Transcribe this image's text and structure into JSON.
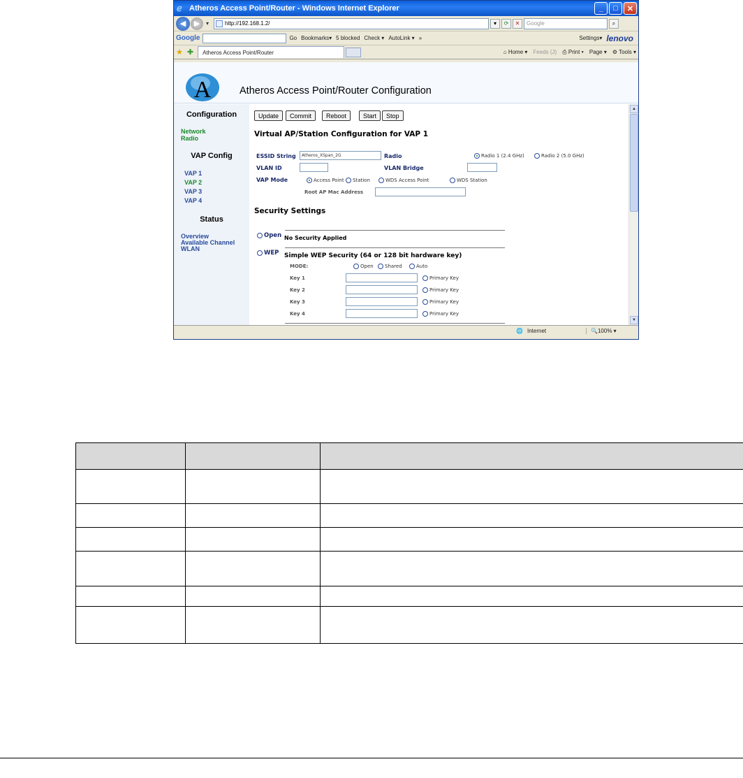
{
  "window": {
    "title": "Atheros Access Point/Router - Windows Internet Explorer"
  },
  "address_bar": {
    "url": "http://192.168.1.2/",
    "search_placeholder": "Google"
  },
  "google_toolbar": {
    "logo": "Google",
    "go": "Go",
    "bookmarks": "Bookmarks▾",
    "blocked": "5 blocked",
    "check": "Check ▾",
    "autolink": "AutoLink ▾",
    "more": "»",
    "settings": "Settings▾",
    "brand": "lenovo"
  },
  "tab_bar": {
    "tab_title": "Atheros Access Point/Router",
    "home": "Home",
    "feeds": "Feeds (J)",
    "print": "Print",
    "page": "Page ▾",
    "tools": "Tools ▾"
  },
  "page": {
    "title": "Atheros Access Point/Router Configuration",
    "logo_letter": "A"
  },
  "sidebar": {
    "config_heading": "Configuration",
    "network": "Network",
    "radio": "Radio",
    "vap_heading": "VAP Config",
    "vaps": [
      "VAP 1",
      "VAP 2",
      "VAP 3",
      "VAP 4"
    ],
    "status_heading": "Status",
    "overview": "Overview",
    "available_channel": "Available Channel",
    "wlan": "WLAN"
  },
  "buttons": {
    "update": "Update",
    "commit": "Commit",
    "reboot": "Reboot",
    "start": "Start",
    "stop": "Stop"
  },
  "vap_form": {
    "heading": "Virtual AP/Station Configuration for VAP 1",
    "essid_label": "ESSID String",
    "essid_value": "Atheros_XSpan_2G",
    "radio_label": "Radio",
    "radio1": "Radio 1 (2.4 GHz)",
    "radio2": "Radio 2 (5.0 GHz)",
    "vlan_id_label": "VLAN ID",
    "vlan_bridge_label": "VLAN Bridge",
    "vap_mode_label": "VAP Mode",
    "mode_ap": "Access Point",
    "mode_station": "Station",
    "mode_wds_ap": "WDS Access Point",
    "mode_wds_station": "WDS Station",
    "root_ap_label": "Root AP Mac Address"
  },
  "security": {
    "heading": "Security Settings",
    "open_label": "Open",
    "open_desc": "No Security Applied",
    "wep_label": "WEP",
    "wep_desc": "Simple WEP Security (64 or 128 bit hardware key)",
    "mode_label": "MODE:",
    "mode_open": "Open",
    "mode_shared": "Shared",
    "mode_auto": "Auto",
    "keys": [
      "Key 1",
      "Key 2",
      "Key 3",
      "Key 4"
    ],
    "primary_key": "Primary Key"
  },
  "status_bar": {
    "zone": "Internet",
    "zoom": "100%"
  }
}
